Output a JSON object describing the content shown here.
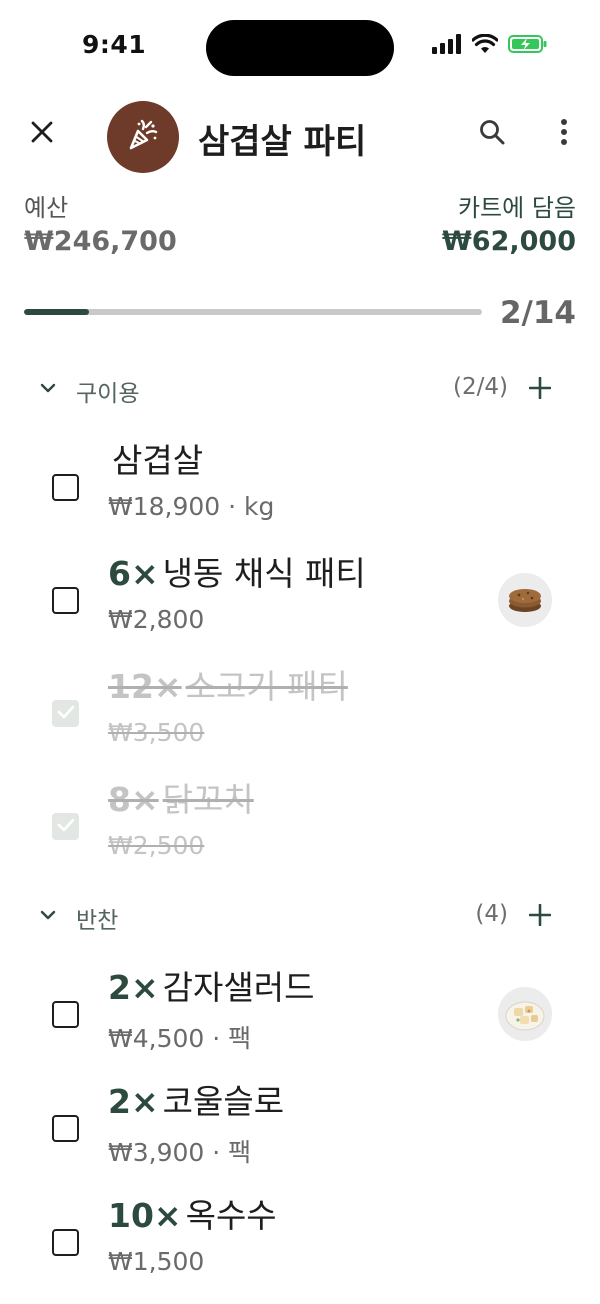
{
  "status_bar": {
    "time": "9:41"
  },
  "header": {
    "title": "삼겹살 파티",
    "avatar_icon": "party-popper-icon"
  },
  "budget": {
    "budget_label": "예산",
    "budget_value": "₩246,700",
    "cart_label": "카트에 담음",
    "cart_value": "₩62,000"
  },
  "progress": {
    "done": 2,
    "total": 14,
    "label": "2/14"
  },
  "colors": {
    "accent": "#2d4a3e",
    "avatar_bg": "#6e3a2a",
    "battery": "#34c759"
  },
  "sections": [
    {
      "title": "구이용",
      "count": "(2/4)",
      "items": [
        {
          "qty": "",
          "name": "삼겹살",
          "price": "₩18,900 · kg",
          "checked": false,
          "thumb": ""
        },
        {
          "qty": "6×",
          "name": "냉동 채식 패티",
          "price": "₩2,800",
          "checked": false,
          "thumb": "veggie-patty-image"
        },
        {
          "qty": "12×",
          "name": "소고기 패티",
          "price": "₩3,500",
          "checked": true,
          "thumb": ""
        },
        {
          "qty": "8×",
          "name": "닭꼬치",
          "price": "₩2,500",
          "checked": true,
          "thumb": ""
        }
      ]
    },
    {
      "title": "반찬",
      "count": "(4)",
      "items": [
        {
          "qty": "2×",
          "name": "감자샐러드",
          "price": "₩4,500 · 팩",
          "checked": false,
          "thumb": "potato-salad-image"
        },
        {
          "qty": "2×",
          "name": "코울슬로",
          "price": "₩3,900 · 팩",
          "checked": false,
          "thumb": ""
        },
        {
          "qty": "10×",
          "name": "옥수수",
          "price": "₩1,500",
          "checked": false,
          "thumb": ""
        }
      ]
    }
  ]
}
